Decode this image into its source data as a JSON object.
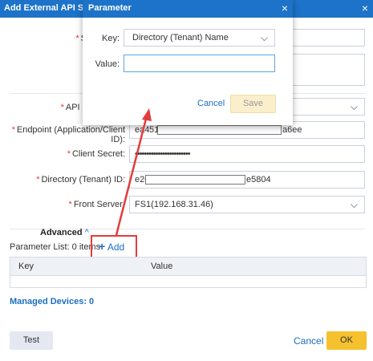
{
  "main_dialog": {
    "title": "Add External API Server",
    "close_icon": "×",
    "fields": {
      "s_label": "S",
      "api_label": "API S",
      "endpoint_label": "Endpoint (Application/Client ID):",
      "endpoint_prefix": "ea4",
      "endpoint_mid": "51",
      "endpoint_suffix": "a6ee",
      "secret_label": "Client Secret:",
      "secret_value": "••••••••••••••••••••••••",
      "directory_label": "Directory (Tenant) ID:",
      "directory_prefix": "e20",
      "directory_suffix": "e5804",
      "front_label": "Front Server:",
      "front_value": "FS1(192.168.31.46)"
    },
    "advanced": {
      "label": "Advanced",
      "caret": "^"
    },
    "parameter_list_label": "Parameter List: 0 items",
    "add_button": {
      "icon": "+",
      "label": "Add"
    },
    "table_columns": [
      "Key",
      "Value"
    ],
    "managed_devices": "Managed Devices: 0",
    "buttons": {
      "test": "Test",
      "cancel": "Cancel",
      "ok": "OK"
    }
  },
  "parameter_popup": {
    "title": "Parameter",
    "close_icon": "×",
    "key_label": "Key:",
    "key_value": "Directory (Tenant) Name",
    "value_label": "Value:",
    "value_input": "",
    "cancel": "Cancel",
    "save": "Save"
  },
  "colors": {
    "title_bar": "#1c73c9",
    "accent_red": "#e33b3b",
    "ok_yellow": "#f5c12e",
    "link_blue": "#1b6ec2"
  }
}
